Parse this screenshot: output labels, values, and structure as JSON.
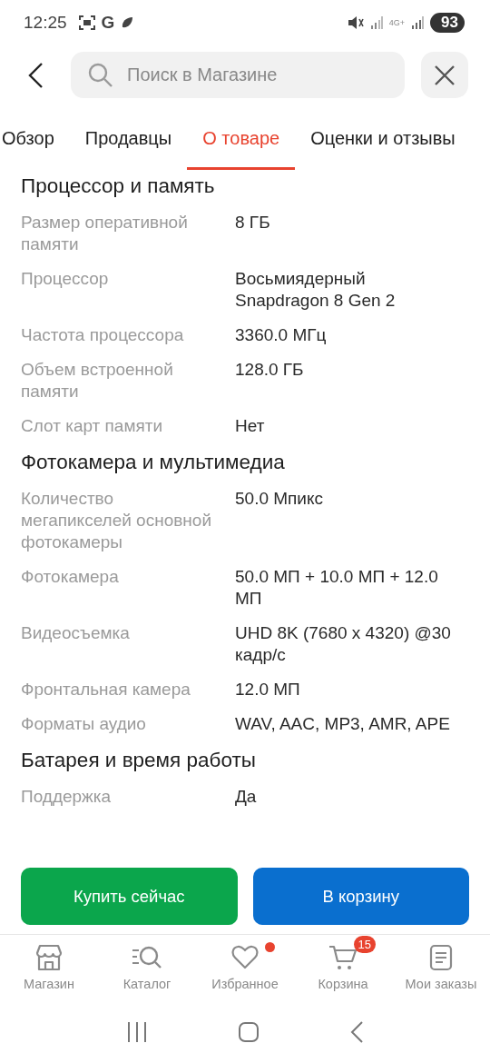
{
  "status_bar": {
    "time": "12:25",
    "app_letter": "G",
    "network": "4G+",
    "battery": "93"
  },
  "search": {
    "placeholder": "Поиск в Магазине"
  },
  "tabs": [
    {
      "label": "Обзор",
      "selected": false
    },
    {
      "label": "Продавцы",
      "selected": false
    },
    {
      "label": "О товаре",
      "selected": true
    },
    {
      "label": "Оценки и отзывы",
      "selected": false
    }
  ],
  "sections": [
    {
      "title": "Процессор и память",
      "rows": [
        {
          "label": "Размер оперативной памяти",
          "value": "8 ГБ"
        },
        {
          "label": "Процессор",
          "value": "Восьмиядерный Snapdragon 8 Gen 2"
        },
        {
          "label": "Частота процессора",
          "value": "3360.0 МГц"
        },
        {
          "label": "Объем встроенной памяти",
          "value": "128.0 ГБ"
        },
        {
          "label": "Слот карт памяти",
          "value": "Нет"
        }
      ]
    },
    {
      "title": "Фотокамера и мультимедиа",
      "rows": [
        {
          "label": "Количество мегапикселей основной фотокамеры",
          "value": "50.0 Мпикс"
        },
        {
          "label": "Фотокамера",
          "value": "50.0 МП + 10.0 МП + 12.0 МП"
        },
        {
          "label": "Видеосъемка",
          "value": "UHD 8K (7680 x 4320) @30 кадр/с"
        },
        {
          "label": "Фронтальная камера",
          "value": "12.0 МП"
        },
        {
          "label": "Форматы аудио",
          "value": "WAV, AAC, MP3, AMR, APE"
        }
      ]
    },
    {
      "title": "Батарея и время работы",
      "rows": [
        {
          "label": "Поддержка",
          "value": "Да"
        }
      ]
    }
  ],
  "actions": [
    {
      "label": "Купить сейчас",
      "kind": "buy"
    },
    {
      "label": "В корзину",
      "kind": "cart"
    }
  ],
  "nav": [
    {
      "label": "Магазин",
      "kind": "shop",
      "dot": false
    },
    {
      "label": "Каталог",
      "kind": "catalog",
      "dot": false
    },
    {
      "label": "Избранное",
      "kind": "favorites",
      "dot": true
    },
    {
      "label": "Корзина",
      "kind": "cart",
      "dot": false,
      "badge": "15"
    },
    {
      "label": "Мои заказы",
      "kind": "orders",
      "dot": false
    }
  ]
}
